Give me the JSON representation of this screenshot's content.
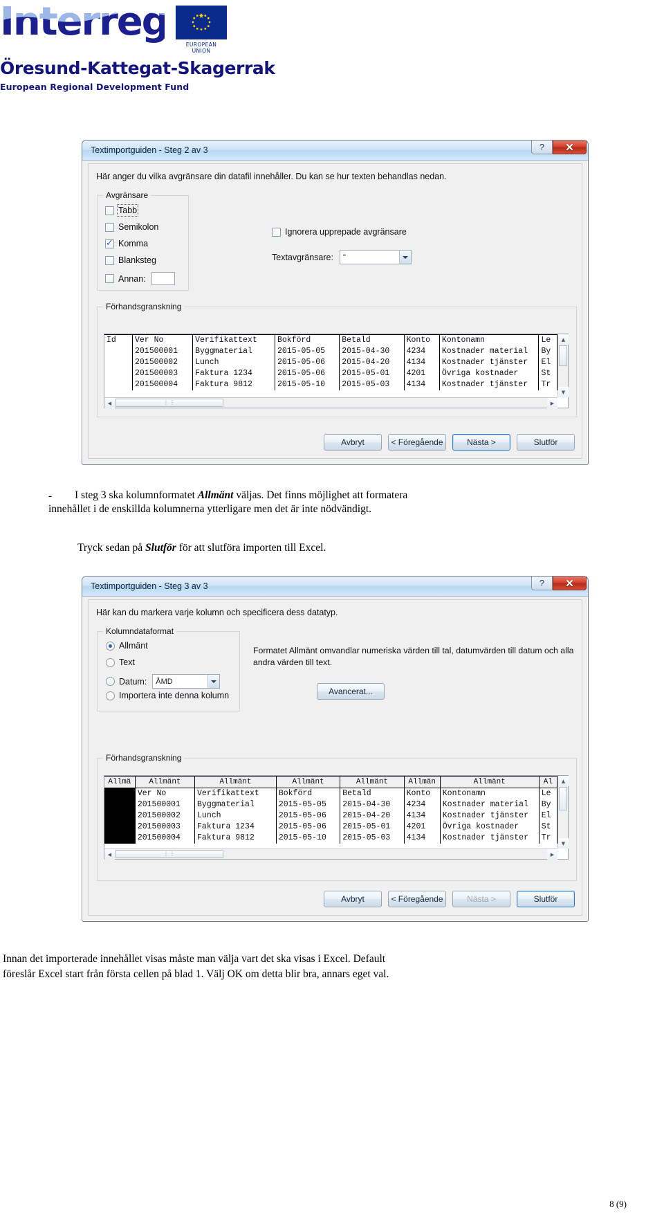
{
  "logo": {
    "wordmark": "Interreg",
    "eu_caption": "EUROPEAN UNION",
    "programme": "Öresund-Kattegat-Skagerrak",
    "fund": "European Regional Development Fund",
    "brand_color": "#13147e",
    "eu_flag_color": "#0a2b8c",
    "eu_star_color": "#f5d800"
  },
  "dialog_step2": {
    "title": "Textimportguiden - Steg 2 av 3",
    "help_icon": "question-mark-icon",
    "close_icon": "close-x-icon",
    "instruction": "Här anger du vilka avgränsare din datafil innehåller. Du kan se hur texten behandlas nedan.",
    "delimiters_group": "Avgränsare",
    "delimiters": [
      {
        "label": "Tabb",
        "checked": false,
        "focused": true
      },
      {
        "label": "Semikolon",
        "checked": false,
        "focused": false
      },
      {
        "label": "Komma",
        "checked": true,
        "focused": false
      },
      {
        "label": "Blanksteg",
        "checked": false,
        "focused": false
      },
      {
        "label": "Annan:",
        "checked": false,
        "focused": false
      }
    ],
    "other_value": "",
    "ignore_repeated": {
      "label": "Ignorera upprepade avgränsare",
      "checked": false
    },
    "text_qualifier_label": "Textavgränsare:",
    "text_qualifier_value": "\"",
    "preview_group": "Förhandsgranskning",
    "buttons": [
      {
        "label": "Avbryt",
        "state": "normal"
      },
      {
        "label": "< Föregående",
        "state": "normal"
      },
      {
        "label": "Nästa >",
        "state": "default"
      },
      {
        "label": "Slutför",
        "state": "normal"
      }
    ]
  },
  "dialog_step3": {
    "title": "Textimportguiden - Steg 3 av 3",
    "help_icon": "question-mark-icon",
    "close_icon": "close-x-icon",
    "instruction": "Här kan du markera varje kolumn och specificera dess datatyp.",
    "format_group": "Kolumndataformat",
    "format_options": [
      {
        "label": "Allmänt",
        "checked": true
      },
      {
        "label": "Text",
        "checked": false
      },
      {
        "label": "Datum:",
        "checked": false
      },
      {
        "label": "Importera inte denna kolumn",
        "checked": false
      }
    ],
    "date_value": "ÅMD",
    "description_line1": "Formatet Allmänt omvandlar numeriska värden till tal, datumvärden till datum och",
    "description_line2": "alla andra värden till text.",
    "advanced_button": "Avancerat...",
    "preview_group": "Förhandsgranskning",
    "column_format_headers": [
      "Allmä",
      "Allmänt",
      "Allmänt",
      "Allmänt",
      "Allmänt",
      "Allmän",
      "Allmänt",
      "Al"
    ],
    "buttons": [
      {
        "label": "Avbryt",
        "state": "normal"
      },
      {
        "label": "< Föregående",
        "state": "normal"
      },
      {
        "label": "Nästa >",
        "state": "disabled"
      },
      {
        "label": "Slutför",
        "state": "default"
      }
    ]
  },
  "preview_table": {
    "columns": [
      "Id",
      "Ver No",
      "Verifikattext",
      "Bokförd",
      "Betald",
      "Konto",
      "Kontonamn",
      "Le"
    ],
    "rows": [
      [
        "",
        "201500001",
        "Byggmaterial",
        "2015-05-05",
        "2015-04-30",
        "4234",
        "Kostnader material",
        "By"
      ],
      [
        "",
        "201500002",
        "Lunch",
        "2015-05-06",
        "2015-04-20",
        "4134",
        "Kostnader tjänster",
        "El"
      ],
      [
        "",
        "201500003",
        "Faktura 1234",
        "2015-05-06",
        "2015-05-01",
        "4201",
        "Övriga kostnader",
        "St"
      ],
      [
        "",
        "201500004",
        "Faktura 9812",
        "2015-05-10",
        "2015-05-03",
        "4134",
        "Kostnader tjänster",
        "Tr"
      ]
    ],
    "scroll_up_icon": "triangle-up-icon",
    "scroll_down_icon": "triangle-down-icon",
    "scroll_left_icon": "triangle-left-icon",
    "scroll_right_icon": "triangle-right-icon",
    "grip_icon": "grip-dots-icon"
  },
  "prose": {
    "bullet_marker": "-",
    "bullet_part1": "I steg 3 ska kolumnformatet ",
    "bullet_emph": "Allmänt",
    "bullet_part2": " väljas.",
    "bullet_part3": " Det finns möjlighet att formatera",
    "bullet_line2": "innehållet i de enskillda kolumnerna ytterligare men det är inte nödvändigt.",
    "press_part1": "Tryck sedan på ",
    "press_emph": "Slutför",
    "press_part2": " för att slutföra importen till Excel.",
    "footer_line1": "Innan det importerade innehållet visas måste man välja vart det ska visas i Excel. Default",
    "footer_line2": "föreslår Excel start från första cellen på blad 1. Välj OK om detta blir bra, annars eget val.",
    "page_number": "8 (9)"
  }
}
